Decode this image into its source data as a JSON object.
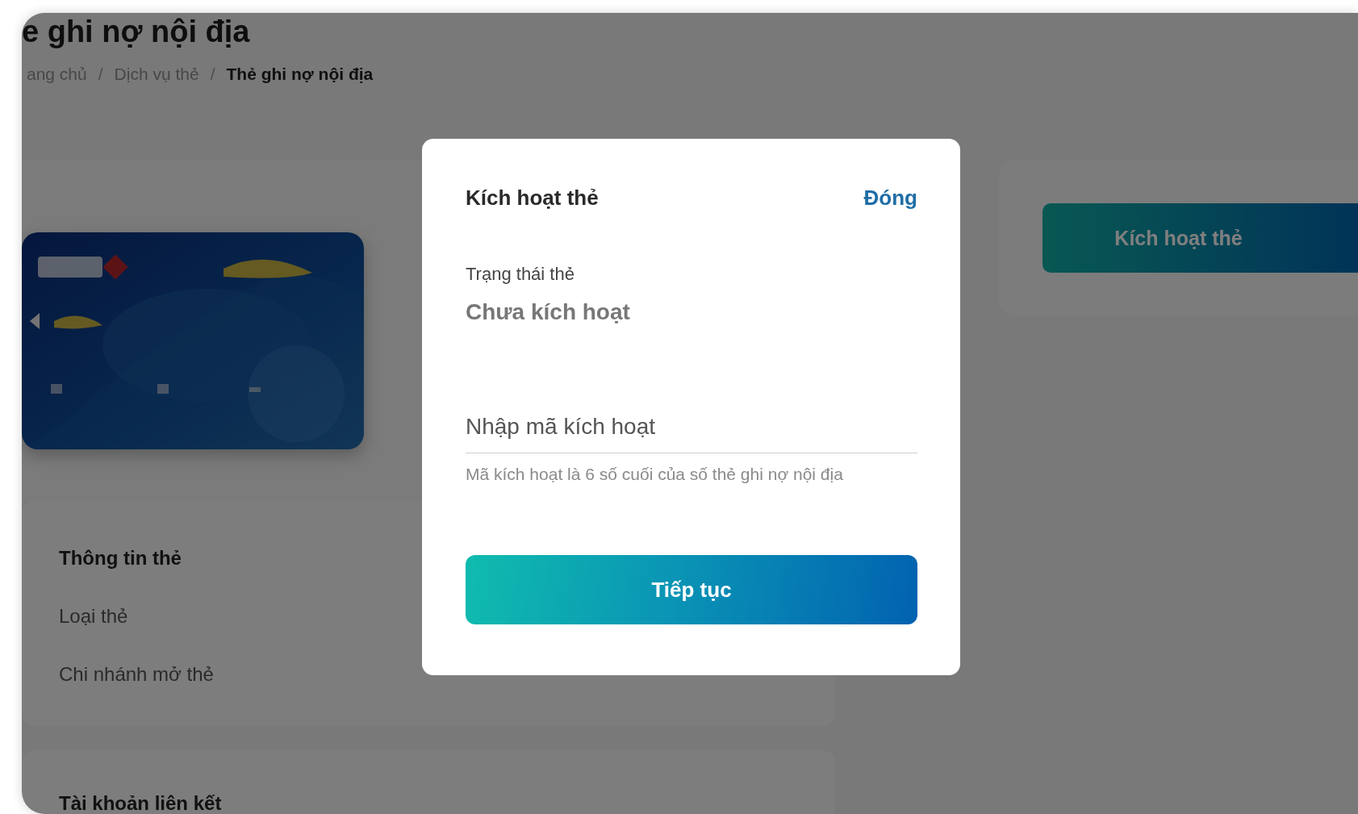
{
  "page": {
    "title": "e ghi nợ nội địa",
    "breadcrumb": [
      {
        "label": "ang chủ",
        "current": false
      },
      {
        "label": "Dịch vụ thẻ",
        "current": false,
        "separator_before": "/"
      },
      {
        "label": "Thẻ ghi nợ nội địa",
        "current": true,
        "separator_before": "/"
      }
    ]
  },
  "card_info": {
    "title": "Thông tin thẻ",
    "rows": [
      "Loại thẻ",
      "Chi nhánh mở thẻ"
    ]
  },
  "linked_accounts": {
    "title": "Tài khoản liên kết"
  },
  "side_action": {
    "label": "Kích hoạt thẻ"
  },
  "dialog": {
    "title": "Kích hoạt thẻ",
    "close": "Đóng",
    "status_label": "Trạng thái thẻ",
    "status_value": "Chưa kích hoạt",
    "code_field": {
      "placeholder": "Nhập mã kích hoạt"
    },
    "hint": "Mã kích hoạt là 6 số cuối của số thẻ ghi nợ nội địa",
    "submit": "Tiếp tục"
  }
}
